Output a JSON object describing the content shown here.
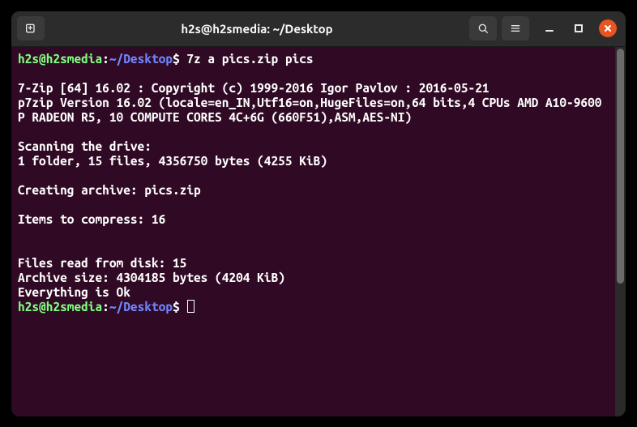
{
  "window": {
    "title": "h2s@h2smedia: ~/Desktop"
  },
  "prompt": {
    "user": "h2s@h2smedia",
    "sep": ":",
    "path": "~/Desktop",
    "symbol": "$"
  },
  "command1": "7z a pics.zip pics",
  "output": {
    "l1": "7-Zip [64] 16.02 : Copyright (c) 1999-2016 Igor Pavlov : 2016-05-21",
    "l2": "p7zip Version 16.02 (locale=en_IN,Utf16=on,HugeFiles=on,64 bits,4 CPUs AMD A10-9600P RADEON R5, 10 COMPUTE CORES 4C+6G (660F51),ASM,AES-NI)",
    "scan": "Scanning the drive:",
    "scanResult": "1 folder, 15 files, 4356750 bytes (4255 KiB)",
    "creating": "Creating archive: pics.zip",
    "items": "Items to compress: 16",
    "filesRead": "Files read from disk: 15",
    "archiveSize": "Archive size: 4304185 bytes (4204 KiB)",
    "ok": "Everything is Ok"
  }
}
